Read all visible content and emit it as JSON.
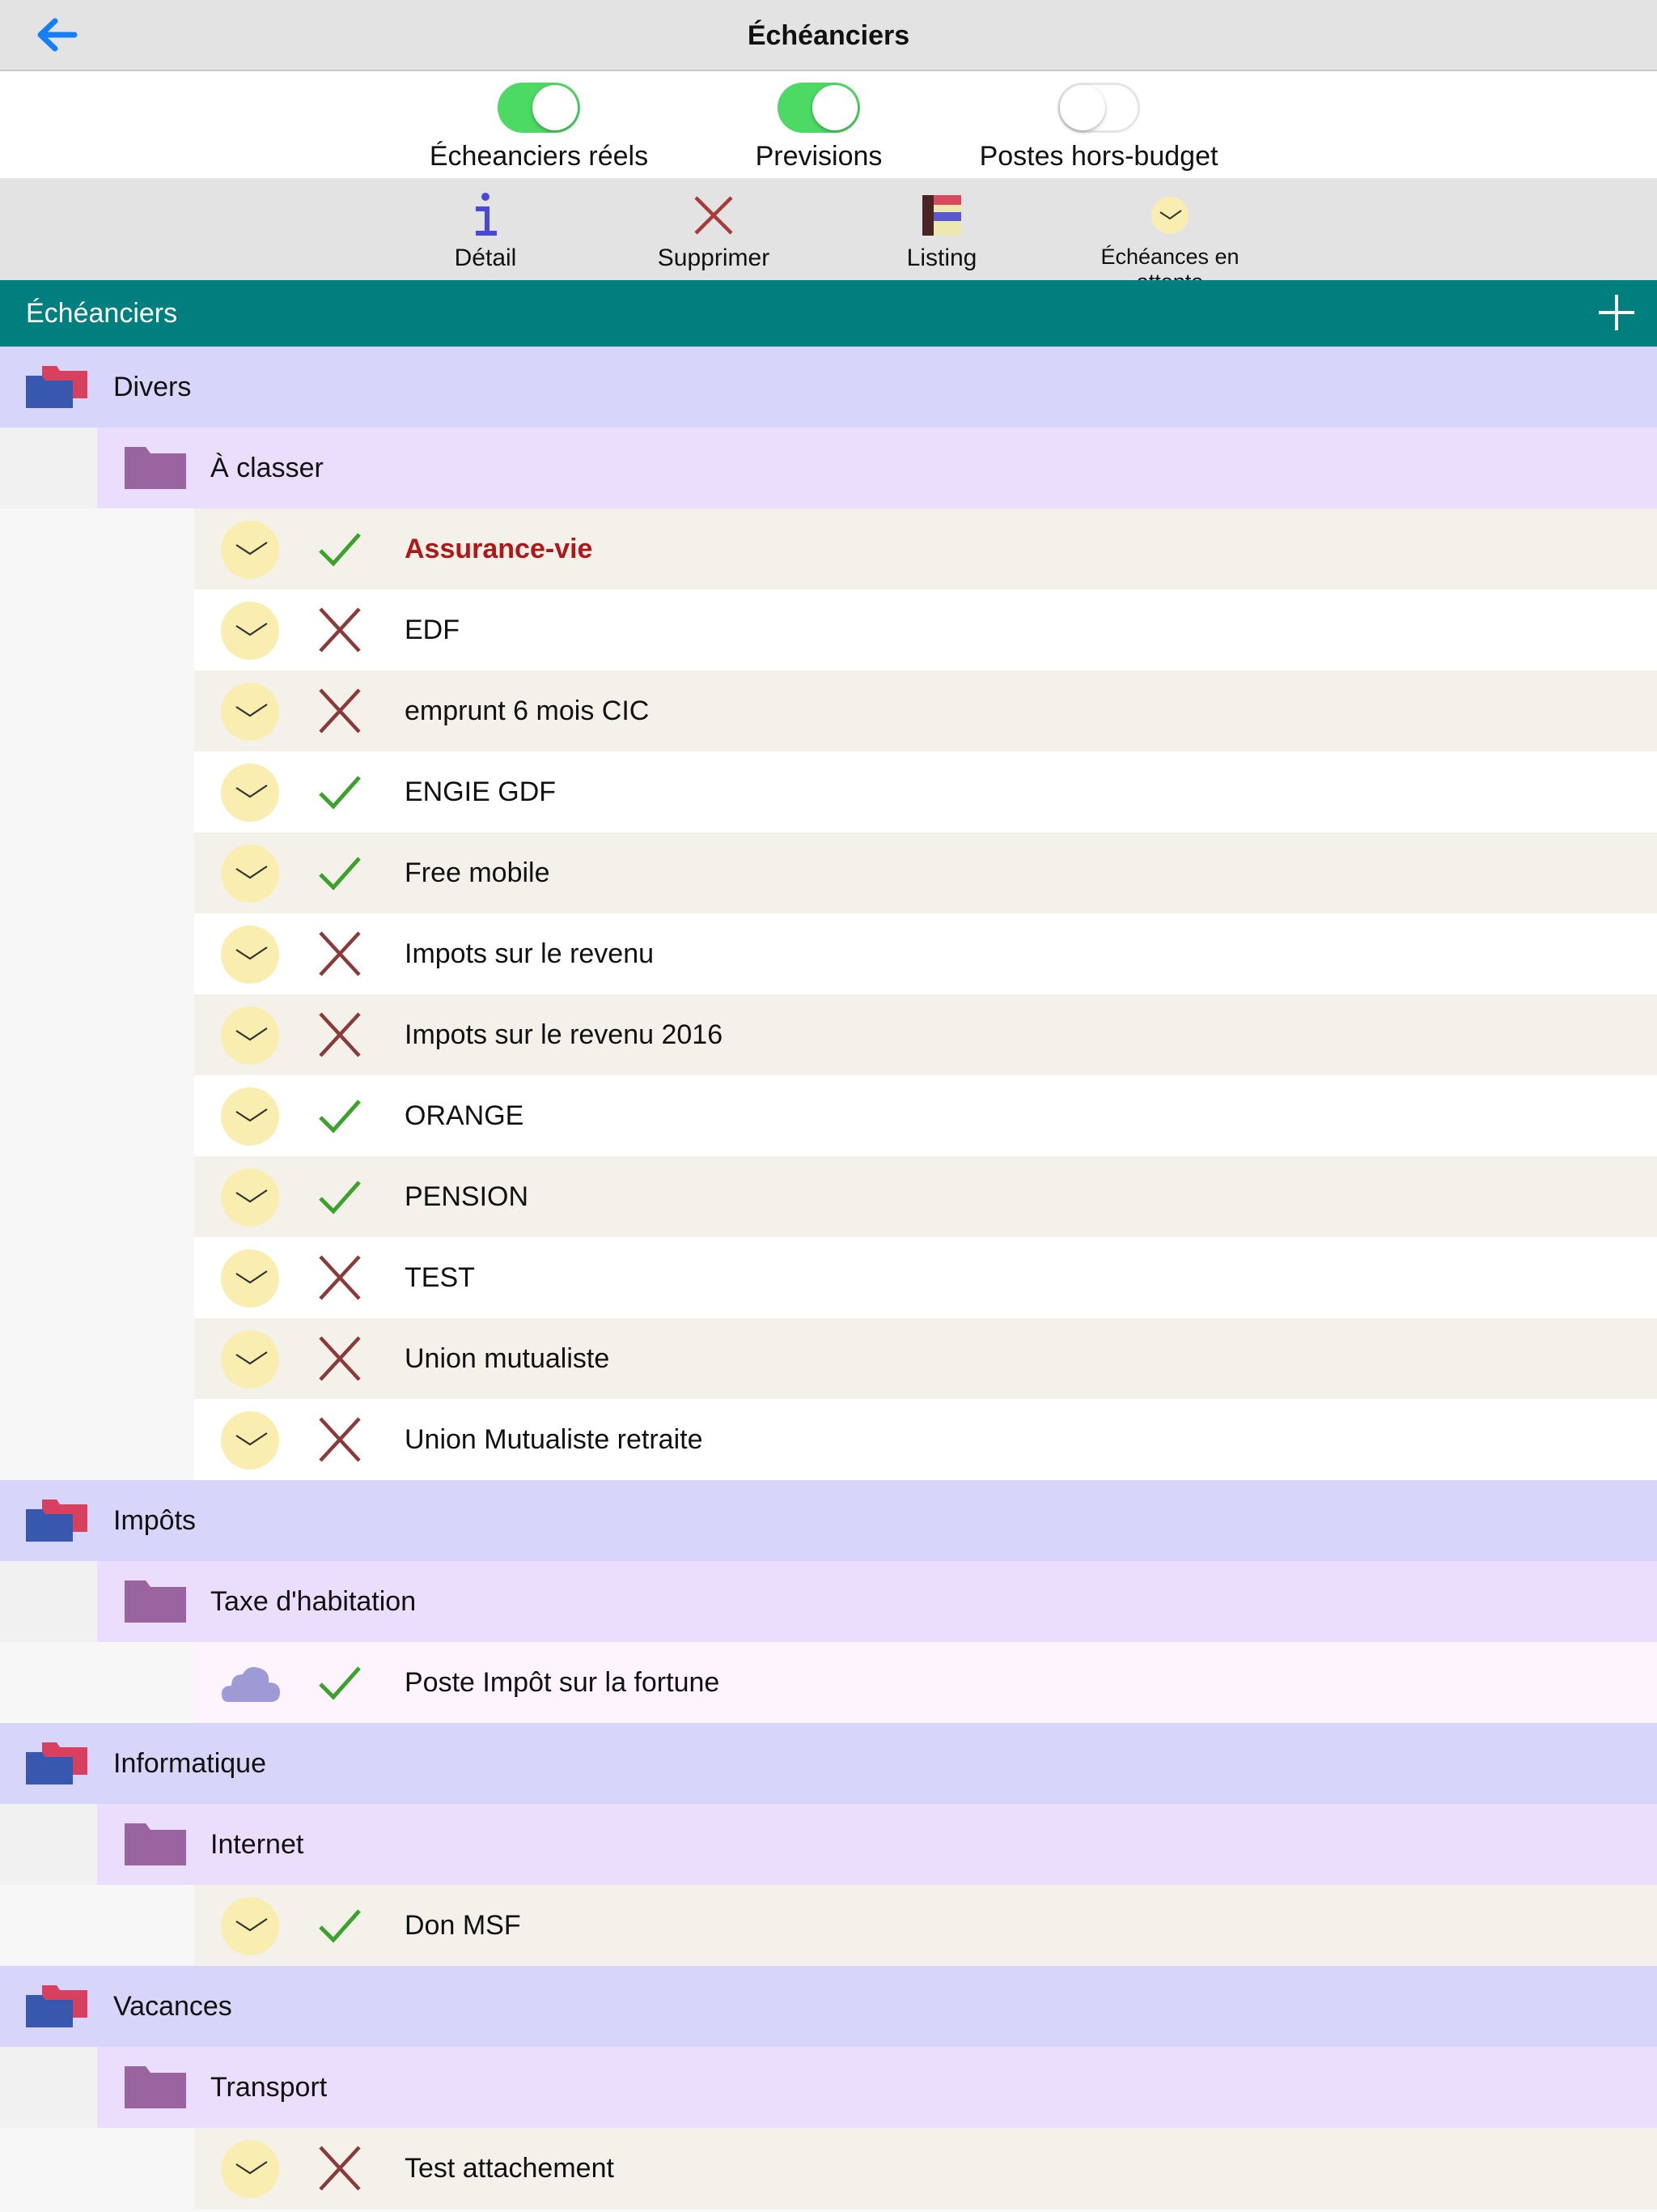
{
  "nav": {
    "title": "Échéanciers",
    "back_icon": "back-arrow-icon"
  },
  "toggles": [
    {
      "label": "Écheanciers réels",
      "on": true
    },
    {
      "label": "Previsions",
      "on": true
    },
    {
      "label": "Postes hors-budget",
      "on": false
    }
  ],
  "toolbar": {
    "detail": "Détail",
    "delete": "Supprimer",
    "listing": "Listing",
    "pending": "Échéances en attente"
  },
  "section": {
    "title": "Échéanciers",
    "add_icon": "plus-icon"
  },
  "colors": {
    "accent": "#007f7f",
    "category_bg": "#d7d5fa",
    "subcategory_bg": "#ebdefc",
    "check": "#3ca22c",
    "cross": "#8b3a3a",
    "clock_face": "#f9eeb0"
  },
  "groups": [
    {
      "name": "Divers",
      "sub": "À classer",
      "items": [
        {
          "label": "Assurance-vie",
          "active": true,
          "icon": "clock",
          "highlight": true
        },
        {
          "label": "EDF",
          "active": false,
          "icon": "clock"
        },
        {
          "label": "emprunt 6 mois CIC",
          "active": false,
          "icon": "clock"
        },
        {
          "label": "ENGIE GDF",
          "active": true,
          "icon": "clock"
        },
        {
          "label": "Free mobile",
          "active": true,
          "icon": "clock"
        },
        {
          "label": "Impots sur le revenu",
          "active": false,
          "icon": "clock"
        },
        {
          "label": "Impots sur le revenu 2016",
          "active": false,
          "icon": "clock"
        },
        {
          "label": "ORANGE",
          "active": true,
          "icon": "clock"
        },
        {
          "label": "PENSION",
          "active": true,
          "icon": "clock"
        },
        {
          "label": "TEST",
          "active": false,
          "icon": "clock"
        },
        {
          "label": "Union mutualiste",
          "active": false,
          "icon": "clock"
        },
        {
          "label": "Union Mutualiste retraite",
          "active": false,
          "icon": "clock"
        }
      ]
    },
    {
      "name": "Impôts",
      "sub": "Taxe d'habitation",
      "items": [
        {
          "label": "Poste Impôt sur la fortune",
          "active": true,
          "icon": "cloud"
        }
      ]
    },
    {
      "name": "Informatique",
      "sub": "Internet",
      "items": [
        {
          "label": "Don MSF",
          "active": true,
          "icon": "clock"
        }
      ]
    },
    {
      "name": "Vacances",
      "sub": "Transport",
      "items": [
        {
          "label": "Test attachement",
          "active": false,
          "icon": "clock"
        }
      ]
    }
  ]
}
